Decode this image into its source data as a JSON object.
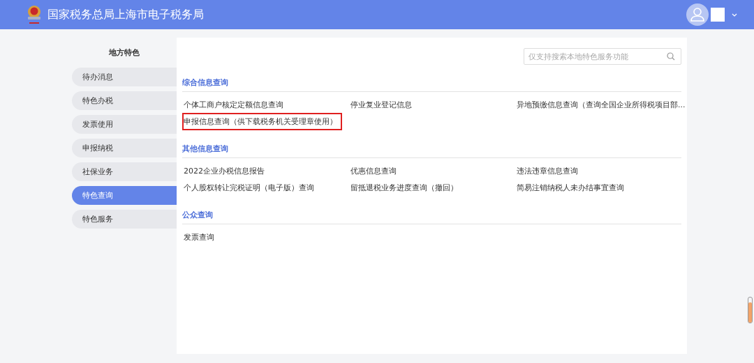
{
  "header": {
    "title": "国家税务总局上海市电子税务局"
  },
  "sidebar": {
    "title": "地方特色",
    "items": [
      {
        "label": "待办消息",
        "selected": false
      },
      {
        "label": "特色办税",
        "selected": false
      },
      {
        "label": "发票使用",
        "selected": false
      },
      {
        "label": "申报纳税",
        "selected": false
      },
      {
        "label": "社保业务",
        "selected": false
      },
      {
        "label": "特色查询",
        "selected": true
      },
      {
        "label": "特色服务",
        "selected": false
      }
    ]
  },
  "search": {
    "placeholder": "仅支持搜索本地特色服务功能"
  },
  "sections": [
    {
      "title": "综合信息查询",
      "links": [
        {
          "label": "个体工商户核定定额信息查询",
          "highlighted": false
        },
        {
          "label": "停业复业登记信息",
          "highlighted": false
        },
        {
          "label": "异地预缴信息查询（查询全国企业所得税项目部...",
          "highlighted": false
        },
        {
          "label": "申报信息查询（供下载税务机关受理章使用）",
          "highlighted": true
        }
      ]
    },
    {
      "title": "其他信息查询",
      "links": [
        {
          "label": "2022企业办税信息报告",
          "highlighted": false
        },
        {
          "label": "优惠信息查询",
          "highlighted": false
        },
        {
          "label": "违法违章信息查询",
          "highlighted": false
        },
        {
          "label": "个人股权转让完税证明（电子版）查询",
          "highlighted": false
        },
        {
          "label": "留抵退税业务进度查询（撤回）",
          "highlighted": false
        },
        {
          "label": "简易注销纳税人未办结事宜查询",
          "highlighted": false
        }
      ]
    },
    {
      "title": "公众查询",
      "links": [
        {
          "label": "发票查询",
          "highlighted": false
        }
      ]
    }
  ]
}
